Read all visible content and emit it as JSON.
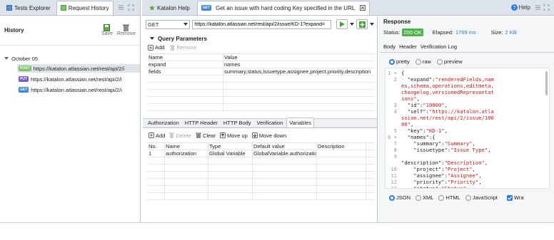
{
  "left": {
    "tabs": [
      {
        "label": "Tests Explorer"
      },
      {
        "label": "Request History"
      }
    ],
    "title": "History",
    "save_label": "Save",
    "remove_label": "Remove",
    "group_label": "October 05",
    "items": [
      {
        "method": "POST",
        "method_color": "#7ec36b",
        "url": "https://katalon.atlassian.net/rest/api/2/i"
      },
      {
        "method": "PUT",
        "method_color": "#7a59c9",
        "url": "https://katalon.atlassian.net/rest/api/2/i"
      },
      {
        "method": "GET",
        "method_color": "#3b86e0",
        "url": "https://katalon.atlassian.net/rest/api/2/i"
      }
    ]
  },
  "editor": {
    "tabs": [
      {
        "label": "Katalon Help"
      },
      {
        "label": "Get an issue with hard coding Key specified in the URL"
      }
    ],
    "get_badge": "GET",
    "method": "GET",
    "url": "https://katalon.atlassian.net/rest/api/2/issue/KD-1?expand=",
    "query_title": "Query Parameters",
    "add_label": "Add",
    "remove_label": "Remove",
    "columns": [
      "Name",
      "Value"
    ],
    "params": [
      {
        "name": "expand",
        "value": "names"
      },
      {
        "name": "fields",
        "value": "summary,status,issuetype,assignee,project,priority,description"
      }
    ],
    "subtabs": [
      "Authorization",
      "HTTP Header",
      "HTTP Body",
      "Verification",
      "Variables"
    ],
    "var_toolbar": {
      "add": "Add",
      "delete": "Delete",
      "clear": "Clear",
      "move_up": "Move up",
      "move_down": "Move down"
    },
    "var_columns": [
      "No.",
      "Name",
      "Type",
      "Default value",
      "Description"
    ],
    "variables": [
      {
        "no": "1",
        "name": "authorization",
        "type": "Global Variable",
        "default": "GlobalVariable.authorization",
        "description": ""
      }
    ]
  },
  "help_label": "Help",
  "response": {
    "title": "Response",
    "status_label": "Status:",
    "status_value": "200 OK",
    "elapsed_label": "Elapsed:",
    "elapsed_value": "1799 ms",
    "size_label": "Size:",
    "size_value": "2 KB",
    "tabs": [
      "Body",
      "Header",
      "Verification Log"
    ],
    "view_modes": [
      "pretty",
      "raw",
      "preview"
    ],
    "formats": [
      "JSON",
      "XML",
      "HTML",
      "JavaScript"
    ],
    "wrap_label": "Wra",
    "colors": {
      "status_bg": "#51b44a",
      "elapsed": "#2f7ae5",
      "string": "#c41a16"
    }
  }
}
